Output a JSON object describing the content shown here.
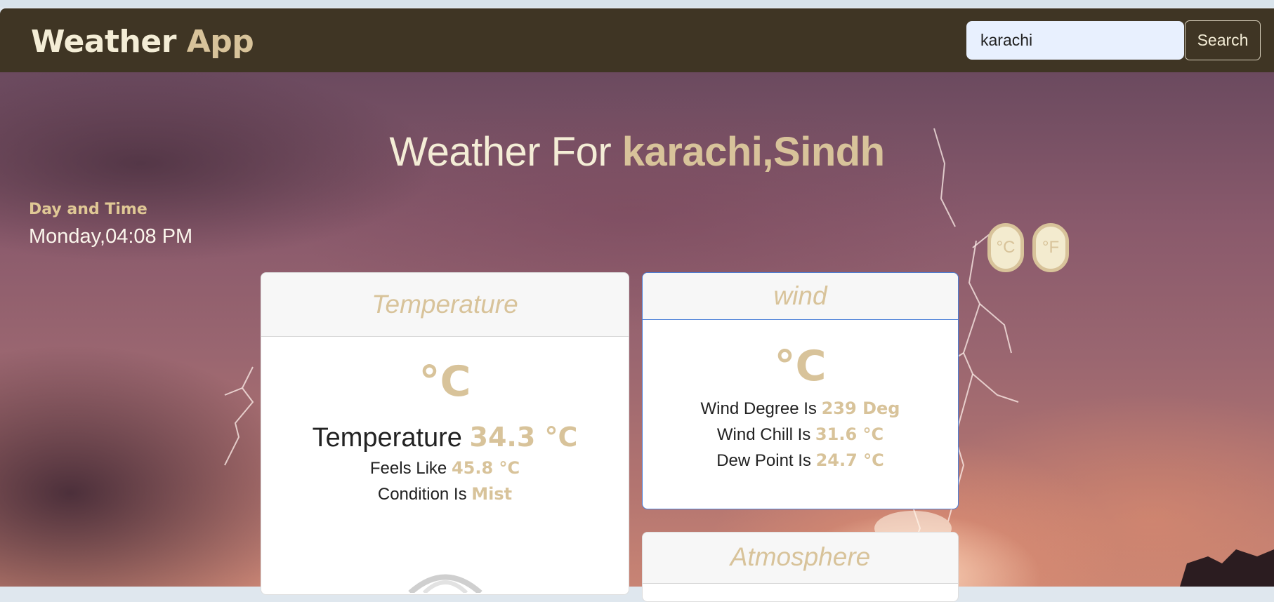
{
  "navbar": {
    "brand_main": "Weather ",
    "brand_accent": "App",
    "search": {
      "value": "karachi",
      "button_label": "Search"
    }
  },
  "headline": {
    "prefix": "Weather For ",
    "location": "karachi,Sindh"
  },
  "datetime": {
    "label": "Day and Time",
    "value": "Monday,04:08 PM"
  },
  "units": {
    "celsius": "°C",
    "fahrenheit": "°F"
  },
  "cards": {
    "temperature": {
      "title": "Temperature",
      "unit_symbol": "°C",
      "temp_label": "Temperature ",
      "temp_value": "34.3 °C",
      "feels_label": "Feels Like ",
      "feels_value": "45.8 °C",
      "condition_label": "Condition Is ",
      "condition_value": "Mist"
    },
    "wind": {
      "title": "wind",
      "unit_symbol": "°C",
      "degree_label": "Wind Degree Is ",
      "degree_value": "239 Deg",
      "chill_label": "Wind Chill Is ",
      "chill_value": "31.6 °C",
      "dew_label": "Dew Point Is ",
      "dew_value": "24.7 °C"
    },
    "atmosphere": {
      "title": "Atmosphere"
    }
  },
  "colors": {
    "navbar": "#3f3524",
    "accent": "#d8c39a",
    "cream": "#f4edd6"
  }
}
